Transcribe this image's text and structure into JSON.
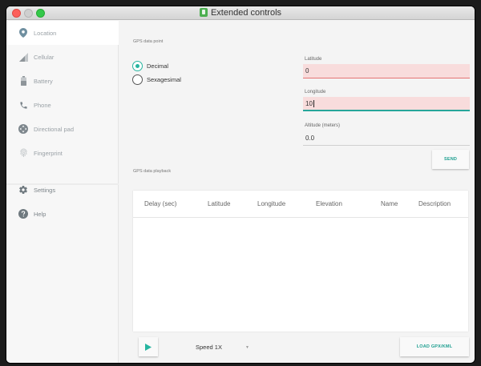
{
  "window": {
    "title": "Extended controls"
  },
  "sidebar": {
    "items": [
      {
        "label": "Location",
        "icon": "location-pin-icon",
        "active": true
      },
      {
        "label": "Cellular",
        "icon": "signal-icon"
      },
      {
        "label": "Battery",
        "icon": "battery-icon"
      },
      {
        "label": "Phone",
        "icon": "phone-icon"
      },
      {
        "label": "Directional pad",
        "icon": "dpad-icon"
      },
      {
        "label": "Fingerprint",
        "icon": "fingerprint-icon"
      },
      {
        "label": "Settings",
        "icon": "gear-icon"
      },
      {
        "label": "Help",
        "icon": "help-icon"
      }
    ]
  },
  "gps_point": {
    "section_label": "GPS data point",
    "formats": [
      {
        "label": "Decimal",
        "checked": true
      },
      {
        "label": "Sexagesimal",
        "checked": false
      }
    ],
    "latitude": {
      "label": "Latitude",
      "value": "0"
    },
    "longitude": {
      "label": "Longitude",
      "value": "10"
    },
    "altitude": {
      "label": "Altitude (meters)",
      "value": "0.0"
    },
    "send_label": "SEND"
  },
  "playback": {
    "section_label": "GPS data playback",
    "columns": [
      "Delay (sec)",
      "Latitude",
      "Longitude",
      "Elevation",
      "Name",
      "Description"
    ],
    "rows": [],
    "speed": "Speed 1X",
    "load_label": "LOAD GPX/KML"
  },
  "colors": {
    "accent": "#26b5a0",
    "error_bg": "#f8dcdc"
  }
}
